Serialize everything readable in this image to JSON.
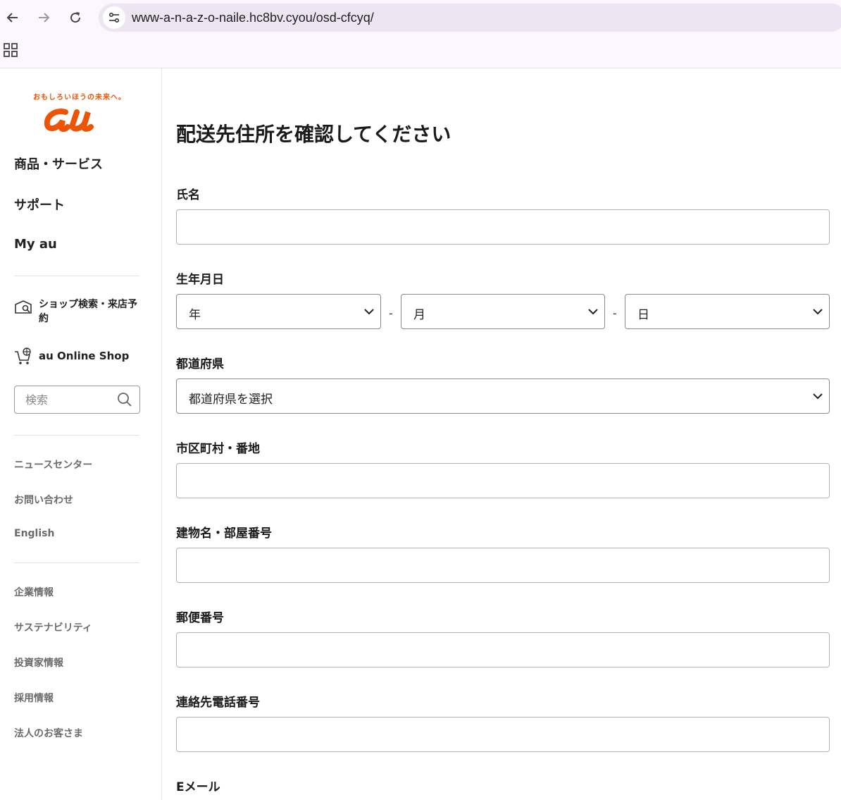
{
  "browser": {
    "url": "www-a-n-a-z-o-naile.hc8bv.cyou/osd-cfcyq/"
  },
  "sidebar": {
    "tagline": "おもしろいほうの未来へ。",
    "logo_text": "au",
    "menu": [
      "商品・サービス",
      "サポート",
      "My au"
    ],
    "shop_search": "ショップ検索・来店予約",
    "online_shop": "au Online Shop",
    "search_placeholder": "検索",
    "links_group1": [
      "ニュースセンター",
      "お問い合わせ",
      "English"
    ],
    "links_group2": [
      "企業情報",
      "サステナビリティ",
      "投資家情報",
      "採用情報",
      "法人のお客さま"
    ]
  },
  "form": {
    "title": "配送先住所を確認してください",
    "name_label": "氏名",
    "birth_label": "生年月日",
    "year_option": "年",
    "month_option": "月",
    "day_option": "日",
    "separator": "-",
    "prefecture_label": "都道府県",
    "prefecture_option": "都道府県を選択",
    "city_label": "市区町村・番地",
    "building_label": "建物名・部屋番号",
    "postal_label": "郵便番号",
    "phone_label": "連絡先電話番号",
    "email_label": "Eメール"
  },
  "colors": {
    "brand": "#eb5505",
    "chrome_bg": "#fcf7ff"
  }
}
